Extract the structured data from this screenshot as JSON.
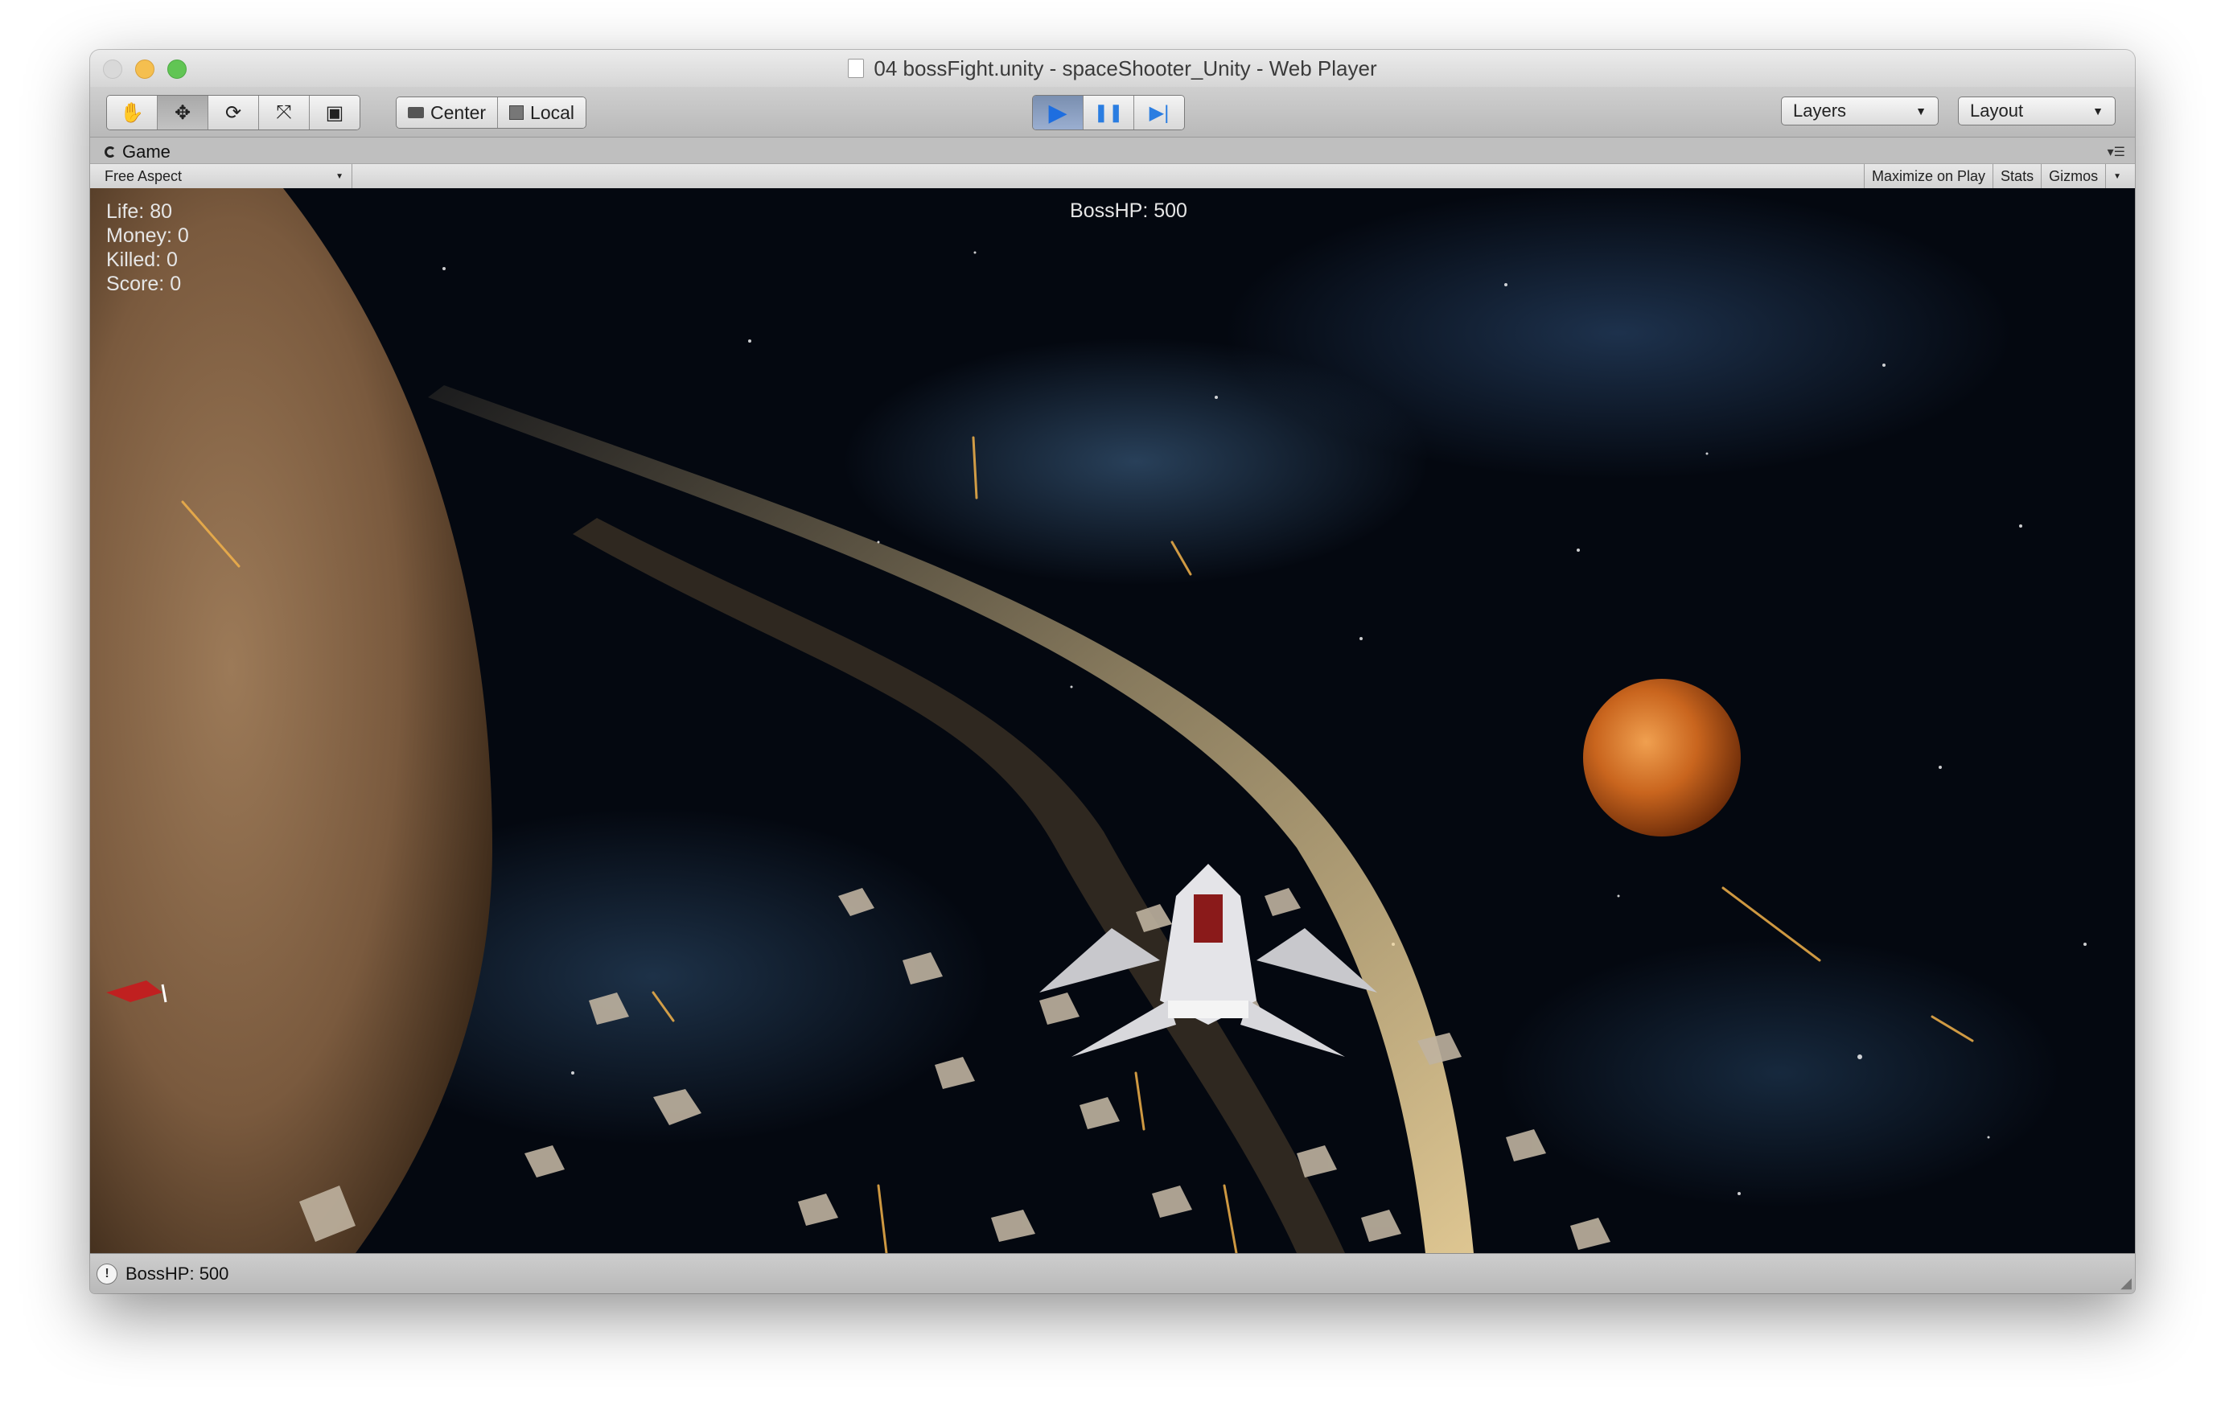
{
  "window": {
    "title": "04 bossFight.unity - spaceShooter_Unity - Web Player"
  },
  "toolbar": {
    "tools": [
      {
        "name": "hand-icon",
        "glyph": "✋"
      },
      {
        "name": "move-icon",
        "glyph": "✥"
      },
      {
        "name": "rotate-icon",
        "glyph": "⟳"
      },
      {
        "name": "scale-icon",
        "glyph": "⤧"
      },
      {
        "name": "rect-icon",
        "glyph": "▣"
      }
    ],
    "pivot_label": "Center",
    "space_label": "Local",
    "play_glyph": "▶",
    "pause_glyph": "❚❚",
    "step_glyph": "▶|",
    "layers_label": "Layers",
    "layout_label": "Layout"
  },
  "game_panel": {
    "tab_label": "Game",
    "aspect_label": "Free Aspect",
    "maximize_label": "Maximize on Play",
    "stats_label": "Stats",
    "gizmos_label": "Gizmos"
  },
  "hud": {
    "life": "Life: 80",
    "money": "Money: 0",
    "killed": "Killed: 0",
    "score": "Score: 0",
    "boss_hp": "BossHP: 500"
  },
  "status": {
    "message": "BossHP: 500"
  },
  "colors": {
    "play_accent": "#2a7de1",
    "space_bg": "#040810",
    "planet_brown": "#8a6a4c",
    "planet_orange": "#c9651e"
  }
}
